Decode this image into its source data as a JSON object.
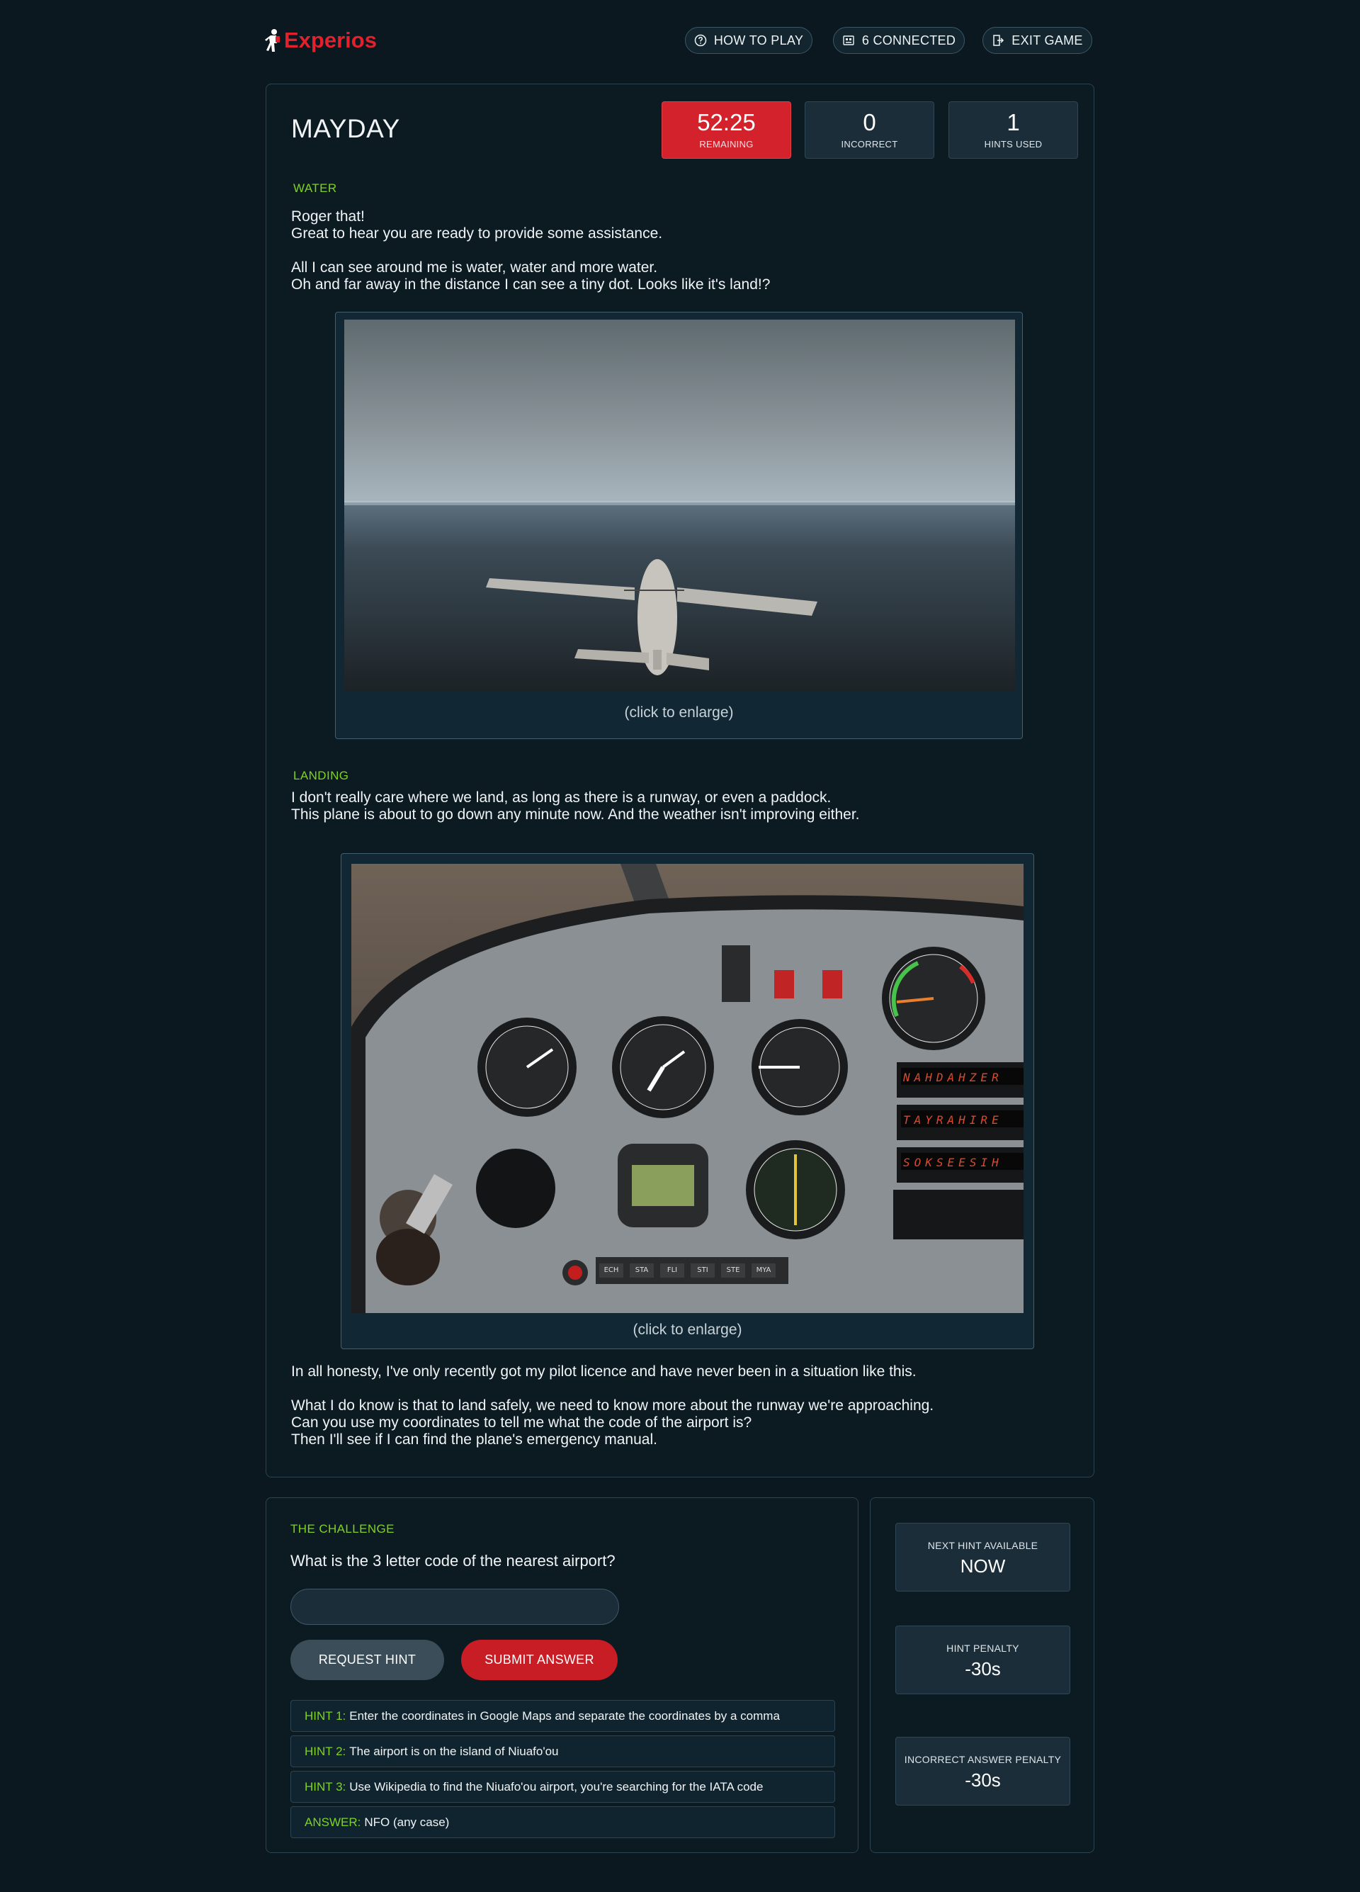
{
  "header": {
    "logo_text": "Experios",
    "nav": [
      {
        "label": "HOW TO PLAY",
        "icon": "help-circle-icon"
      },
      {
        "label": "6 CONNECTED",
        "icon": "players-icon"
      },
      {
        "label": "EXIT GAME",
        "icon": "exit-door-icon"
      }
    ]
  },
  "game": {
    "title": "MAYDAY",
    "stats": [
      {
        "value": "52:25",
        "label": "REMAINING",
        "color": "#d3222c"
      },
      {
        "value": "0",
        "label": "INCORRECT"
      },
      {
        "value": "1",
        "label": "HINTS USED"
      }
    ]
  },
  "sections": {
    "water": {
      "label": "WATER",
      "text_1": "Roger that!\nGreat to hear you are ready to provide some assistance.",
      "text_2": "All I can see around me is water, water and more water.\nOh and far away in the distance I can see a tiny dot. Looks like it's land!?",
      "image_caption": "(click to enlarge)"
    },
    "landing": {
      "label": "LANDING",
      "text_1": "I don't really care where we land, as long as there is a runway, or even a paddock.\nThis plane is about to go down any minute now. And the weather isn't improving either.",
      "image_caption": "(click to enlarge)",
      "text_2": "In all honesty, I've only recently got my pilot licence and have never been in a situation like this.",
      "text_3": "What I do know is that to land safely, we need to know more about the runway we're approaching.\nCan you use my coordinates to tell me what the code of the airport is?\nThen I'll see if I can find the plane's emergency manual."
    }
  },
  "challenge": {
    "label": "THE CHALLENGE",
    "question": "What is the 3 letter code of the nearest airport?",
    "input_value": "",
    "request_hint_label": "REQUEST HINT",
    "submit_label": "SUBMIT ANSWER",
    "hints": [
      {
        "prefix": "HINT 1:",
        "text": "Enter the coordinates in Google Maps and separate the coordinates by a comma"
      },
      {
        "prefix": "HINT 2:",
        "text": "The airport is on the island of Niuafo'ou"
      },
      {
        "prefix": "HINT 3:",
        "text": "Use Wikipedia to find the Niuafo'ou airport, you're searching for the IATA code"
      },
      {
        "prefix": "ANSWER:",
        "text": "NFO (any case)"
      }
    ]
  },
  "sidebar": {
    "boxes": [
      {
        "label": "NEXT HINT AVAILABLE",
        "value": "NOW"
      },
      {
        "label": "HINT PENALTY",
        "value": "-30s"
      },
      {
        "label": "INCORRECT ANSWER PENALTY",
        "value": "-30s"
      }
    ]
  },
  "colors": {
    "background": "#0b1820",
    "accent_green": "#7ed321",
    "accent_red": "#d3222c"
  },
  "cockpit_readouts": {
    "display_1": "NAHDAHZER",
    "display_2": "TAYRAHIRE",
    "display_3": "SOKSEESIH",
    "buttons": [
      "ECH",
      "STA",
      "FLI",
      "STI",
      "STE",
      "MYA"
    ]
  }
}
